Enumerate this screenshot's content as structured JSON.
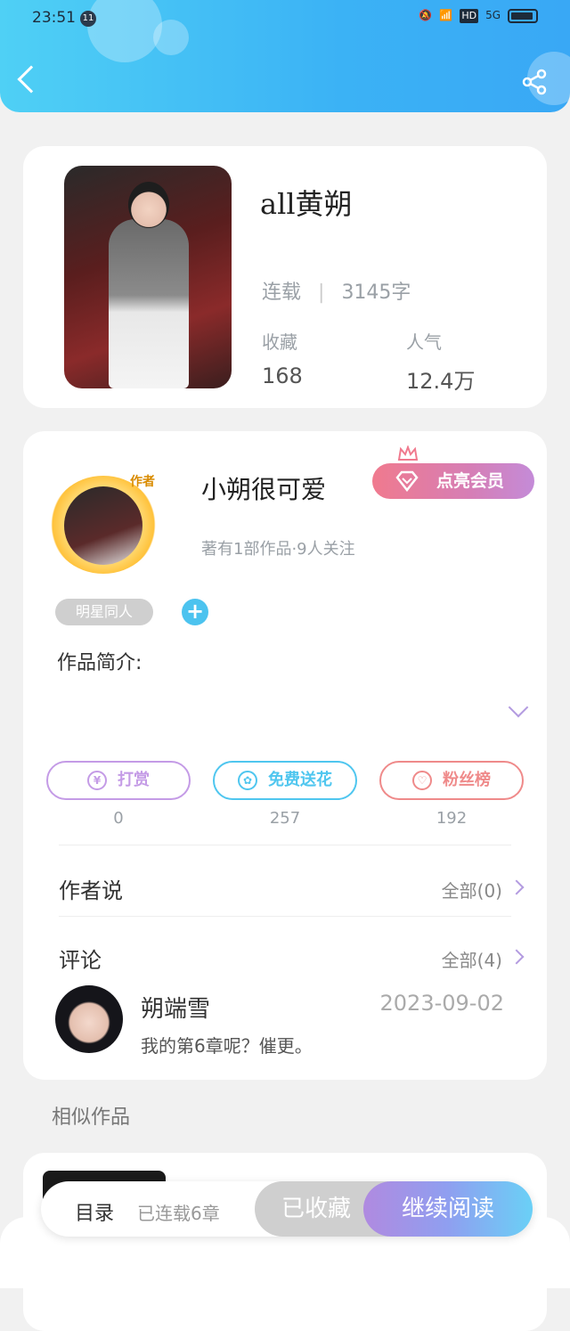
{
  "status_bar": {
    "time": "23:51",
    "notification_badge": "11",
    "network": "HD",
    "signal": "5G"
  },
  "book": {
    "title": "all黄朔",
    "serial_status": "连载",
    "word_count": "3145字",
    "collect_label": "收藏",
    "collect_value": "168",
    "popularity_label": "人气",
    "popularity_value": "12.4万"
  },
  "author": {
    "avatar_tag": "作者",
    "name": "小朔很可爱",
    "vip_label": "点亮会员",
    "works": "著有1部作品·9人关注",
    "genre": "明星同人",
    "intro_label": "作品简介:"
  },
  "actions": [
    {
      "label": "打赏",
      "count": "0",
      "icon": "yen-icon",
      "color": "#c49be6"
    },
    {
      "label": "免费送花",
      "count": "257",
      "icon": "flower-icon",
      "color": "#4fc6ef"
    },
    {
      "label": "粉丝榜",
      "count": "192",
      "icon": "fans-icon",
      "color": "#ef8a8a"
    }
  ],
  "author_says": {
    "label": "作者说",
    "all": "全部(0)"
  },
  "comments": {
    "label": "评论",
    "all": "全部(4)",
    "items": [
      {
        "name": "朔端雪",
        "date": "2023-09-02",
        "text": "我的第6章呢？催更。"
      }
    ]
  },
  "similar_label": "相似作品",
  "bottom_bar": {
    "toc": "目录",
    "serialized": "已连载6章",
    "collected": "已收藏",
    "continue_read": "继续阅读"
  }
}
